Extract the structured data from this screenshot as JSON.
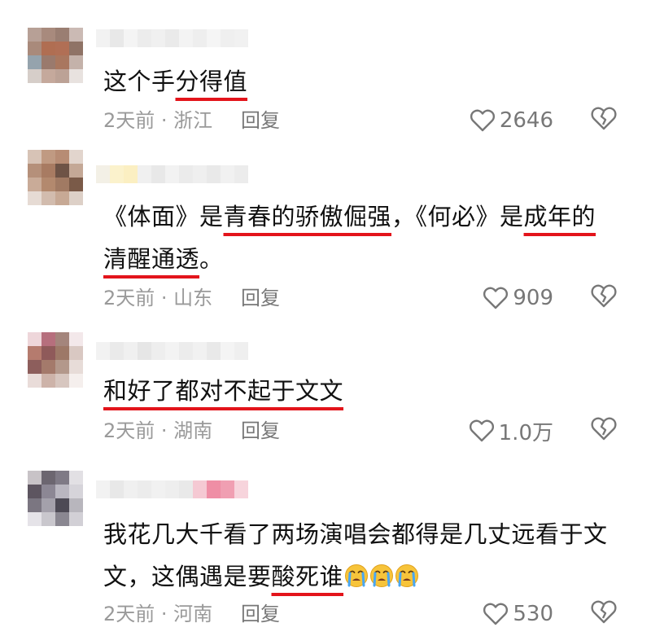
{
  "comments": [
    {
      "segments": [
        {
          "text": "这个手",
          "hl": false
        },
        {
          "text": "分得值",
          "hl": true
        }
      ],
      "time": "2天前",
      "location": "浙江",
      "reply": "回复",
      "likes": "2646",
      "avatar_colors": [
        "#b7a096",
        "#a88a7d",
        "#9a7e72",
        "#cbbab4",
        "#a98a7b",
        "#b06e52",
        "#b16f55",
        "#8f7366",
        "#95a3ad",
        "#9a7a6d",
        "#a9775f",
        "#c4b2aa",
        "#d6cec9",
        "#c5a99c",
        "#bca296",
        "#e8e2df"
      ],
      "username_colors": [
        "#f2f2f2",
        "#e8e8e8",
        "#f4f4f4",
        "#ececec",
        "#f0f0f0",
        "#eaeaea",
        "#f3f3f3",
        "#eeeeee",
        "#f5f5f5",
        "#efefef",
        "#f1f1f1"
      ]
    },
    {
      "segments": [
        {
          "text": "《体面》是",
          "hl": false
        },
        {
          "text": "青春的骄傲倔强",
          "hl": true
        },
        {
          "text": "，《何必》是",
          "hl": false
        },
        {
          "text": "成年的",
          "hl": true
        },
        {
          "text": "清醒通透",
          "hl": true
        },
        {
          "text": "。",
          "hl": false
        }
      ],
      "time": "2天前",
      "location": "山东",
      "reply": "回复",
      "likes": "909",
      "avatar_colors": [
        "#d7c3b6",
        "#c09a82",
        "#b78c74",
        "#e2d5cd",
        "#b5907a",
        "#a87b62",
        "#6e5346",
        "#c4a896",
        "#c9ab98",
        "#b3896e",
        "#a17a63",
        "#7a5a48",
        "#e6dbd4",
        "#d2bcae",
        "#c7a995",
        "#ddd0c7"
      ],
      "username_colors": [
        "#f3f0e6",
        "#fbf2cc",
        "#fbefc2",
        "#f0f0f0",
        "#e8e8e8",
        "#f2f2f2",
        "#ebebeb",
        "#efefef",
        "#e9e9e9",
        "#f1f1f1",
        "#ececec"
      ]
    },
    {
      "segments": [
        {
          "text": "和好了都对不起于文文",
          "hl": true
        }
      ],
      "time": "2天前",
      "location": "湖南",
      "reply": "回复",
      "likes": "1.0万",
      "avatar_colors": [
        "#eed6da",
        "#b66f7d",
        "#a4857c",
        "#f3e8ea",
        "#b57b6e",
        "#8f5a5a",
        "#9d7867",
        "#d9c8c2",
        "#8d5e5c",
        "#a47a6b",
        "#b3988b",
        "#e7dcd8",
        "#e9dcd9",
        "#cdb3a9",
        "#d7c6bf",
        "#f5efed"
      ],
      "username_colors": [
        "#f2f2f2",
        "#eaeaea",
        "#f0f0f0",
        "#e6e6e6",
        "#eeeeee",
        "#f3f3f3",
        "#ececec",
        "#f1f1f1",
        "#e9e9e9",
        "#f4f4f4",
        "#efefef"
      ]
    },
    {
      "segments": [
        {
          "text": "我花几大千看了两场演唱会都得是几丈远看于文文，这偶遇是要",
          "hl": false
        },
        {
          "text": "酸死谁",
          "hl": true
        }
      ],
      "emoji_count": 3,
      "time": "2天前",
      "location": "河南",
      "reply": "回复",
      "likes": "530",
      "avatar_colors": [
        "#c8c3c7",
        "#6c6670",
        "#7f7a86",
        "#e2e0e4",
        "#5d5560",
        "#8c8794",
        "#b9b6c0",
        "#d6d4da",
        "#7b7681",
        "#a4a1ab",
        "#4d4a55",
        "#b8b6bd",
        "#e5e3e8",
        "#c9c7cd",
        "#8a8791",
        "#d2d0d6"
      ],
      "username_colors": [
        "#f2f2f2",
        "#e8e8e8",
        "#f0f0f0",
        "#ececec",
        "#f1f1f1",
        "#eeeeee",
        "#e9e9e9",
        "#f5c9d3",
        "#ef8ea5",
        "#f09fb2",
        "#f7d4dc"
      ]
    }
  ],
  "icons": {
    "like": "heart-outline-icon",
    "dislike": "broken-heart-icon",
    "emoji": "loudly-crying-face-emoji"
  },
  "colors": {
    "highlight": "#e3141b",
    "meta": "#9a9a9a",
    "text": "#111111"
  }
}
